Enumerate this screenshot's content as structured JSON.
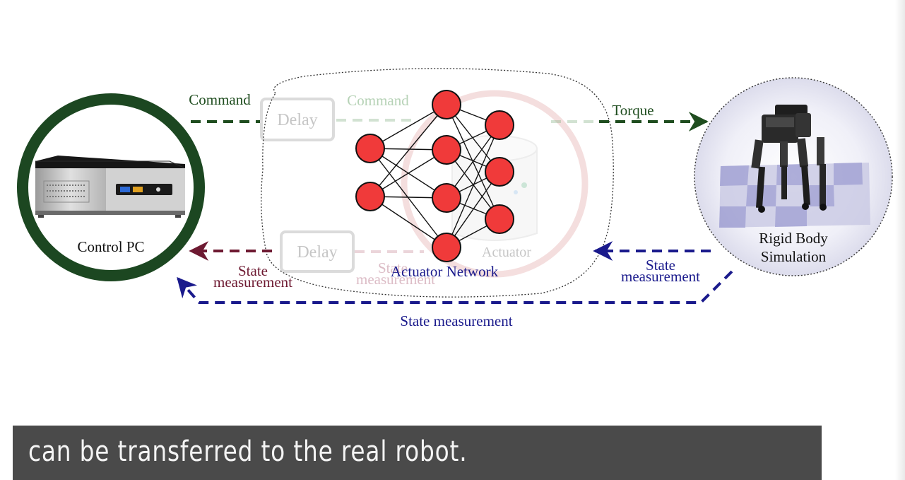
{
  "diagram": {
    "control_pc": {
      "label": "Control PC"
    },
    "rigid_body": {
      "label_line1": "Rigid Body",
      "label_line2": "Simulation"
    },
    "actuator_network": {
      "label": "Actuator Network"
    },
    "faded": {
      "delay_top": "Delay",
      "delay_bottom": "Delay",
      "command": "Command",
      "state_line1": "State",
      "state_line2": "measurement",
      "actuator": "Actuator"
    },
    "edges": {
      "command": "Command",
      "torque": "Torque",
      "state_left_line1": "State",
      "state_left_line2": "measurement",
      "state_right_line1": "State",
      "state_right_line2": "measurement",
      "state_bottom": "State measurement"
    },
    "colors": {
      "green": "#1f4d1f",
      "maroon": "#6e1a32",
      "navy": "#1a1a8c",
      "node": "#f03a3a",
      "pc_ring": "#1c4721"
    }
  },
  "caption": {
    "text": "can be transferred to the real robot."
  }
}
